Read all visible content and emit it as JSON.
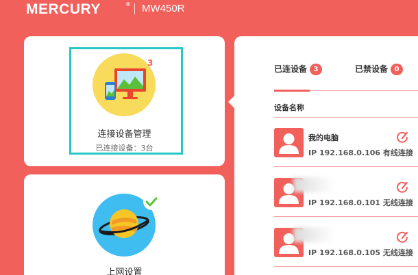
{
  "header": {
    "brand": "MERCURY",
    "brand_mark": "®",
    "model": "MW450R"
  },
  "cards": {
    "devices": {
      "title": "连接设备管理",
      "subtitle": "已连接设备：3台",
      "count_badge": "3",
      "icon": "monitor-phone-icon"
    },
    "internet": {
      "title": "上网设置",
      "icon": "planet-icon",
      "status_icon": "check-icon"
    }
  },
  "panel": {
    "tabs": [
      {
        "label": "已连设备",
        "count": "3"
      },
      {
        "label": "已禁设备",
        "count": "0"
      }
    ],
    "column_header": "设备名称",
    "devices": [
      {
        "name": "我的电脑",
        "ip": "IP 192.168.0.106",
        "connection": "有线连接"
      },
      {
        "name": "",
        "ip": "IP 192.168.0.101",
        "connection": "无线连接"
      },
      {
        "name": "",
        "ip": "IP 192.168.0.105",
        "connection": "无线连接"
      }
    ]
  },
  "colors": {
    "background": "#f2605c",
    "accent_teal": "#27c6c8",
    "devices_icon_bg": "#f8db5b",
    "internet_icon_bg": "#3fbdf0",
    "check_green": "#58c432"
  }
}
